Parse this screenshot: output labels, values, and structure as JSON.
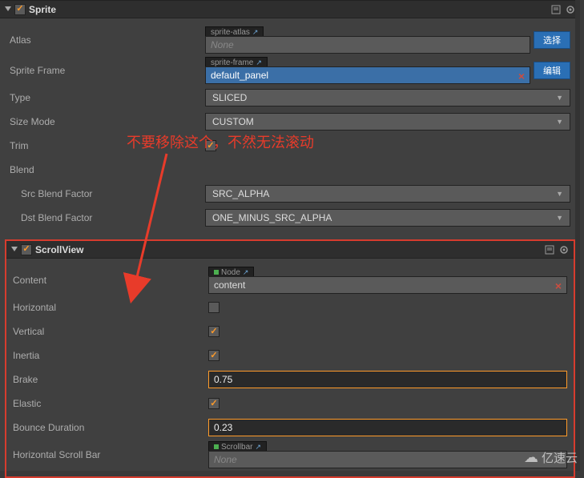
{
  "sprite": {
    "title": "Sprite",
    "enabled": true,
    "atlas": {
      "label": "Atlas",
      "tag": "sprite-atlas",
      "value": "None",
      "button": "选择"
    },
    "spriteFrame": {
      "label": "Sprite Frame",
      "tag": "sprite-frame",
      "value": "default_panel",
      "button": "编辑"
    },
    "type": {
      "label": "Type",
      "value": "SLICED"
    },
    "sizeMode": {
      "label": "Size Mode",
      "value": "CUSTOM"
    },
    "trim": {
      "label": "Trim",
      "checked": true
    },
    "blend": {
      "label": "Blend"
    },
    "srcBlend": {
      "label": "Src Blend Factor",
      "value": "SRC_ALPHA"
    },
    "dstBlend": {
      "label": "Dst Blend Factor",
      "value": "ONE_MINUS_SRC_ALPHA"
    }
  },
  "scrollView": {
    "title": "ScrollView",
    "enabled": true,
    "content": {
      "label": "Content",
      "tag": "Node",
      "value": "content"
    },
    "horizontal": {
      "label": "Horizontal",
      "checked": false
    },
    "vertical": {
      "label": "Vertical",
      "checked": true
    },
    "inertia": {
      "label": "Inertia",
      "checked": true
    },
    "brake": {
      "label": "Brake",
      "value": "0.75"
    },
    "elastic": {
      "label": "Elastic",
      "checked": true
    },
    "bounceDuration": {
      "label": "Bounce Duration",
      "value": "0.23"
    },
    "horizontalScrollBar": {
      "label": "Horizontal Scroll Bar",
      "tag": "Scrollbar",
      "value": "None"
    }
  },
  "annotation": "不要移除这个，不然无法滚动",
  "watermark": "亿速云"
}
